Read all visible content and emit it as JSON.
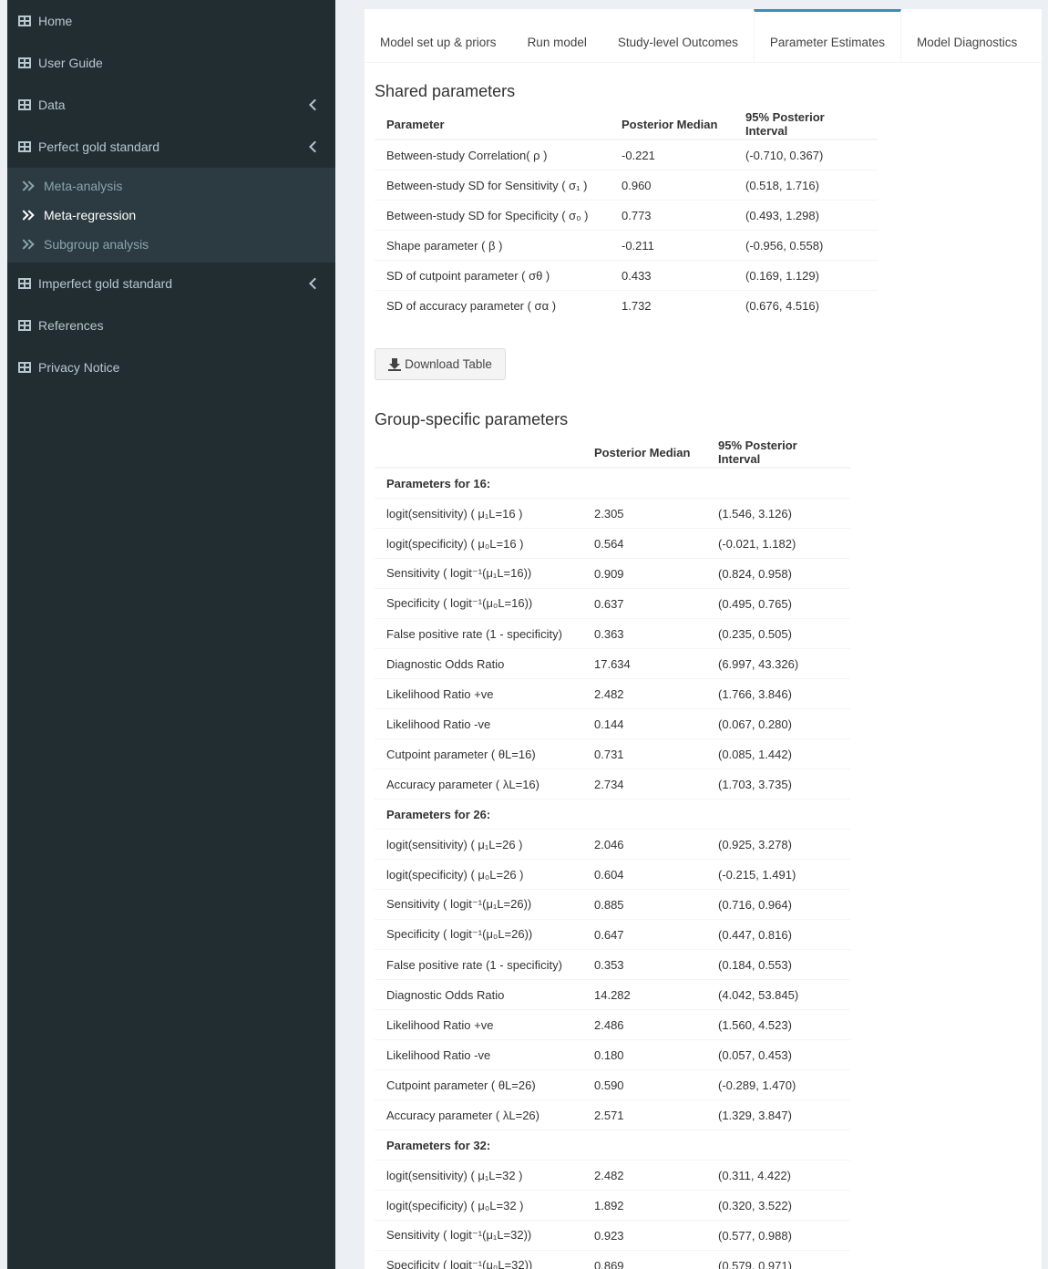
{
  "sidebar": {
    "items": [
      {
        "label": "Home"
      },
      {
        "label": "User Guide"
      },
      {
        "label": "Data"
      },
      {
        "label": "Perfect gold standard"
      },
      {
        "label": "Imperfect gold standard"
      },
      {
        "label": "References"
      },
      {
        "label": "Privacy Notice"
      }
    ],
    "submenu": [
      {
        "label": "Meta-analysis"
      },
      {
        "label": "Meta-regression"
      },
      {
        "label": "Subgroup analysis"
      }
    ]
  },
  "tabs": [
    {
      "label": "Model set up & priors"
    },
    {
      "label": "Run model"
    },
    {
      "label": "Study-level Outcomes"
    },
    {
      "label": "Parameter Estimates"
    },
    {
      "label": "Model Diagnostics"
    }
  ],
  "shared": {
    "title": "Shared parameters",
    "headers": [
      "Parameter",
      "Posterior Median",
      "95% Posterior Interval"
    ],
    "rows": [
      {
        "param": "Between-study Correlation( ρ )",
        "median": "-0.221",
        "interval": "(-0.710, 0.367)"
      },
      {
        "param": "Between-study SD for Sensitivity ( σ₁ )",
        "median": "0.960",
        "interval": "(0.518, 1.716)"
      },
      {
        "param": "Between-study SD for Specificity ( σ₀ )",
        "median": "0.773",
        "interval": "(0.493, 1.298)"
      },
      {
        "param": "Shape parameter ( β )",
        "median": "-0.211",
        "interval": "(-0.956, 0.558)"
      },
      {
        "param": "SD of cutpoint parameter ( σθ )",
        "median": "0.433",
        "interval": "(0.169, 1.129)"
      },
      {
        "param": "SD of accuracy parameter ( σα )",
        "median": "1.732",
        "interval": "(0.676, 4.516)"
      }
    ]
  },
  "download_label": "Download Table",
  "group": {
    "title": "Group-specific parameters",
    "headers": [
      "",
      "Posterior Median",
      "95% Posterior Interval"
    ],
    "groups": [
      {
        "heading": "Parameters for 16:",
        "rows": [
          {
            "param": "logit(sensitivity) ( μ₁L=16 )",
            "median": "2.305",
            "interval": "(1.546, 3.126)"
          },
          {
            "param": "logit(specificity) ( μ₀L=16 )",
            "median": "0.564",
            "interval": "(-0.021, 1.182)"
          },
          {
            "param": "Sensitivity ( logit⁻¹(μ₁L=16))",
            "median": "0.909",
            "interval": "(0.824, 0.958)"
          },
          {
            "param": "Specificity ( logit⁻¹(μ₀L=16))",
            "median": "0.637",
            "interval": "(0.495, 0.765)"
          },
          {
            "param": "False positive rate (1 - specificity)",
            "median": "0.363",
            "interval": "(0.235, 0.505)"
          },
          {
            "param": "Diagnostic Odds Ratio",
            "median": "17.634",
            "interval": "(6.997, 43.326)"
          },
          {
            "param": "Likelihood Ratio +ve",
            "median": "2.482",
            "interval": "(1.766, 3.846)"
          },
          {
            "param": "Likelihood Ratio -ve",
            "median": "0.144",
            "interval": "(0.067, 0.280)"
          },
          {
            "param": "Cutpoint parameter ( θL=16)",
            "median": "0.731",
            "interval": "(0.085, 1.442)"
          },
          {
            "param": "Accuracy parameter ( λL=16)",
            "median": "2.734",
            "interval": "(1.703, 3.735)"
          }
        ]
      },
      {
        "heading": "Parameters for 26:",
        "rows": [
          {
            "param": "logit(sensitivity) ( μ₁L=26 )",
            "median": "2.046",
            "interval": "(0.925, 3.278)"
          },
          {
            "param": "logit(specificity) ( μ₀L=26 )",
            "median": "0.604",
            "interval": "(-0.215, 1.491)"
          },
          {
            "param": "Sensitivity ( logit⁻¹(μ₁L=26))",
            "median": "0.885",
            "interval": "(0.716, 0.964)"
          },
          {
            "param": "Specificity ( logit⁻¹(μ₀L=26))",
            "median": "0.647",
            "interval": "(0.447, 0.816)"
          },
          {
            "param": "False positive rate (1 - specificity)",
            "median": "0.353",
            "interval": "(0.184, 0.553)"
          },
          {
            "param": "Diagnostic Odds Ratio",
            "median": "14.282",
            "interval": "(4.042, 53.845)"
          },
          {
            "param": "Likelihood Ratio +ve",
            "median": "2.486",
            "interval": "(1.560, 4.523)"
          },
          {
            "param": "Likelihood Ratio -ve",
            "median": "0.180",
            "interval": "(0.057, 0.453)"
          },
          {
            "param": "Cutpoint parameter ( θL=26)",
            "median": "0.590",
            "interval": "(-0.289, 1.470)"
          },
          {
            "param": "Accuracy parameter ( λL=26)",
            "median": "2.571",
            "interval": "(1.329, 3.847)"
          }
        ]
      },
      {
        "heading": "Parameters for 32:",
        "rows": [
          {
            "param": "logit(sensitivity) ( μ₁L=32 )",
            "median": "2.482",
            "interval": "(0.311, 4.422)"
          },
          {
            "param": "logit(specificity) ( μ₀L=32 )",
            "median": "1.892",
            "interval": "(0.320, 3.522)"
          },
          {
            "param": "Sensitivity ( logit⁻¹(μ₁L=32))",
            "median": "0.923",
            "interval": "(0.577, 0.988)"
          },
          {
            "param": "Specificity ( logit⁻¹(μ₀L=32))",
            "median": "0.869",
            "interval": "(0.579, 0.971)"
          }
        ]
      }
    ]
  },
  "colors": {
    "sidebar_bg": "#222d32",
    "submenu_bg": "#2c3b41",
    "accent": "#3c8dbc",
    "page_bg": "#ecf0f5"
  }
}
